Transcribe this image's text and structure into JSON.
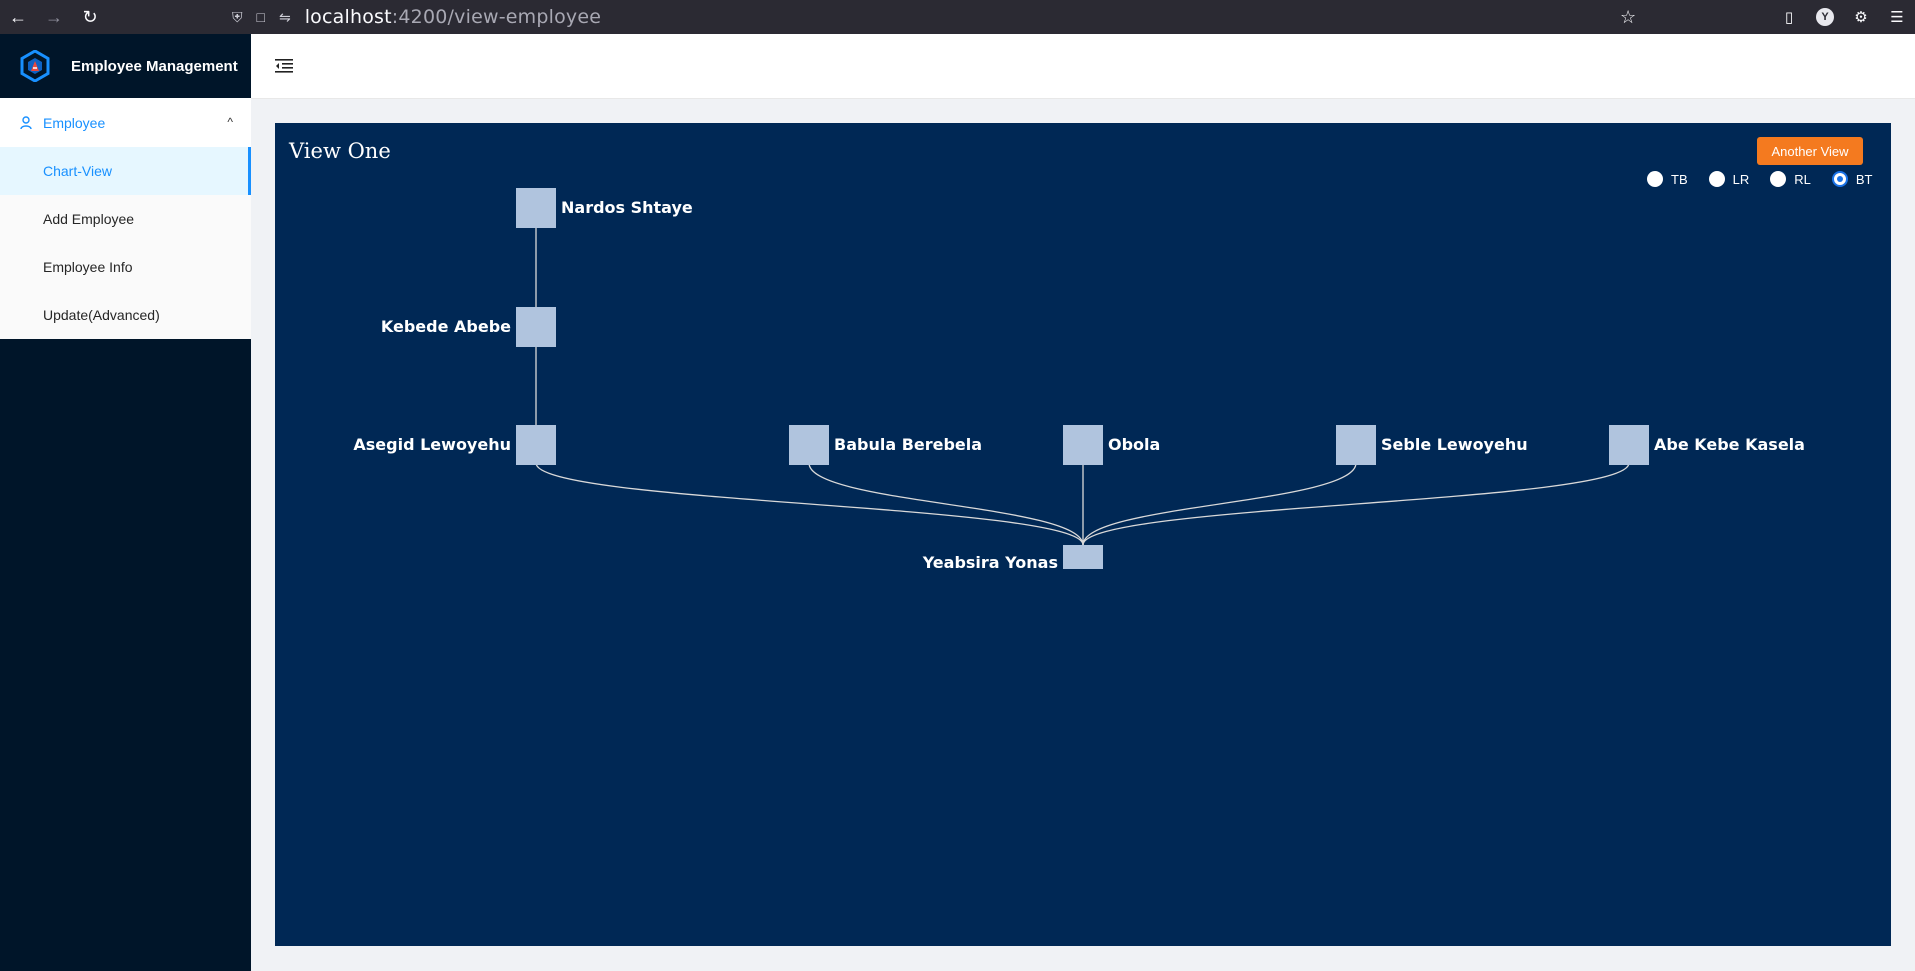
{
  "browser": {
    "url_host": "localhost",
    "url_path": ":4200/view-employee"
  },
  "sidebar": {
    "app_title": "Employee Management",
    "group_label": "Employee",
    "items": [
      {
        "label": "Chart-View",
        "active": true
      },
      {
        "label": "Add Employee",
        "active": false
      },
      {
        "label": "Employee Info",
        "active": false
      },
      {
        "label": "Update(Advanced)",
        "active": false
      }
    ]
  },
  "main": {
    "view_title": "View One",
    "another_view_label": "Another View",
    "orientation_options": [
      {
        "label": "TB",
        "checked": false
      },
      {
        "label": "LR",
        "checked": false
      },
      {
        "label": "RL",
        "checked": false
      },
      {
        "label": "BT",
        "checked": true
      }
    ],
    "accent_color": "#f47a1f",
    "canvas_color": "#002855",
    "node_color": "#b0c4de"
  },
  "tree": {
    "orientation": "BT",
    "root": "Yeabsira Yonas",
    "nodes": [
      {
        "id": "yeabsira",
        "name": "Yeabsira Yonas",
        "parent": null
      },
      {
        "id": "asegid",
        "name": "Asegid Lewoyehu",
        "parent": "yeabsira"
      },
      {
        "id": "babula",
        "name": "Babula Berebela",
        "parent": "yeabsira"
      },
      {
        "id": "obola",
        "name": "Obola",
        "parent": "yeabsira"
      },
      {
        "id": "seble",
        "name": "Seble Lewoyehu",
        "parent": "yeabsira"
      },
      {
        "id": "abe",
        "name": "Abe Kebe Kasela",
        "parent": "yeabsira"
      },
      {
        "id": "kebede",
        "name": "Kebede Abebe",
        "parent": "asegid"
      },
      {
        "id": "nardos",
        "name": "Nardos Shtaye",
        "parent": "kebede"
      }
    ]
  }
}
